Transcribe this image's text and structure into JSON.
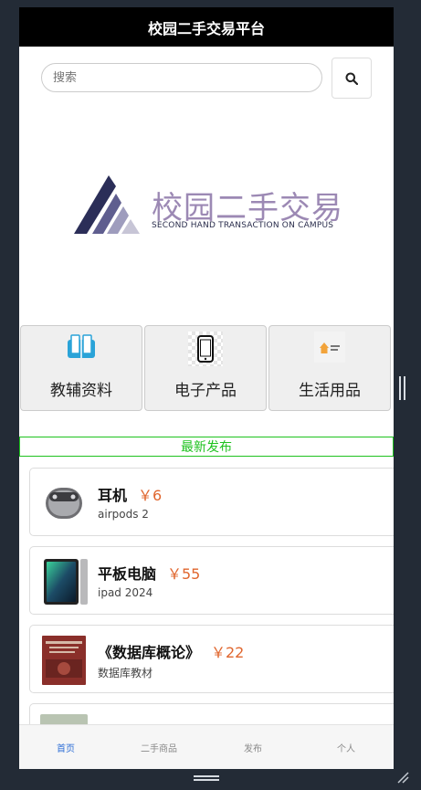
{
  "app": {
    "title": "校园二手交易平台"
  },
  "search": {
    "placeholder": "搜索"
  },
  "banner": {
    "title": "校园二手交易",
    "subtitle": "SECOND HAND TRANSACTION ON CAMPUS"
  },
  "categories": [
    {
      "label": "教辅资料",
      "icon": "books-icon"
    },
    {
      "label": "电子产品",
      "icon": "phone-icon"
    },
    {
      "label": "生活用品",
      "icon": "household-icon"
    }
  ],
  "section": {
    "title": "最新发布"
  },
  "listings": [
    {
      "title": "耳机",
      "price": "￥6",
      "desc": "airpods 2",
      "icon": "earbuds-icon"
    },
    {
      "title": "平板电脑",
      "price": "￥55",
      "desc": "ipad 2024",
      "icon": "tablet-icon"
    },
    {
      "title": "《数据库概论》",
      "price": "￥22",
      "desc": "数据库教材",
      "icon": "book-cover-icon"
    }
  ],
  "tabs": [
    {
      "label": "首页",
      "active": true
    },
    {
      "label": "二手商品",
      "active": false
    },
    {
      "label": "发布",
      "active": false
    },
    {
      "label": "个人",
      "active": false
    }
  ],
  "colors": {
    "accent_green": "#1ec21e",
    "price_orange": "#e0662e",
    "tab_active": "#2f6fd6",
    "logo_purple": "#9c89b4"
  }
}
